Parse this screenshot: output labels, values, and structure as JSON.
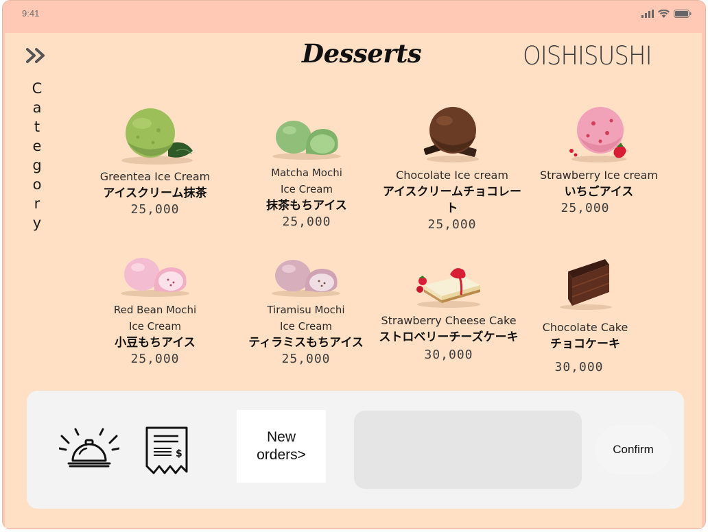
{
  "status_bar": {
    "time": "9:41"
  },
  "header": {
    "title": "Desserts",
    "brand": "OISHISUSHI"
  },
  "sidebar": {
    "toggle_icon": "double-chevron-right-icon",
    "category_label": [
      "C",
      "a",
      "t",
      "e",
      "g",
      "o",
      "r",
      "y"
    ]
  },
  "menu_items": [
    {
      "name_en": "Greentea Ice Cream",
      "name_jp": "アイスクリーム抹茶",
      "price": "25,000"
    },
    {
      "name_en": "Matcha Mochi",
      "name_en_2": "Ice Cream",
      "name_jp": "抹茶もちアイス",
      "price": "25,000"
    },
    {
      "name_en": "Chocolate Ice cream",
      "name_jp": "アイスクリームチョコレート",
      "price": "25,000"
    },
    {
      "name_en": "Strawberry Ice cream",
      "name_jp": "いちごアイス",
      "price": "25,000"
    },
    {
      "name_en": "Red Bean Mochi",
      "name_en_2": "Ice Cream",
      "name_jp": "小豆もちアイス",
      "price": "25,000"
    },
    {
      "name_en": "Tiramisu Mochi",
      "name_en_2": "Ice Cream",
      "name_jp": "ティラミスもちアイス",
      "price": "25,000"
    },
    {
      "name_en": "Strawberry Cheese Cake",
      "name_jp": "ストロベリーチーズケーキ",
      "price": "30,000"
    },
    {
      "name_en": "Chocolate Cake",
      "name_jp": "チョコケーキ",
      "price": "30,000"
    }
  ],
  "bottom_bar": {
    "new_orders_line1": "New",
    "new_orders_line2": "orders>",
    "confirm_label": "Confirm",
    "bell_icon": "service-bell-icon",
    "receipt_icon": "receipt-icon"
  }
}
